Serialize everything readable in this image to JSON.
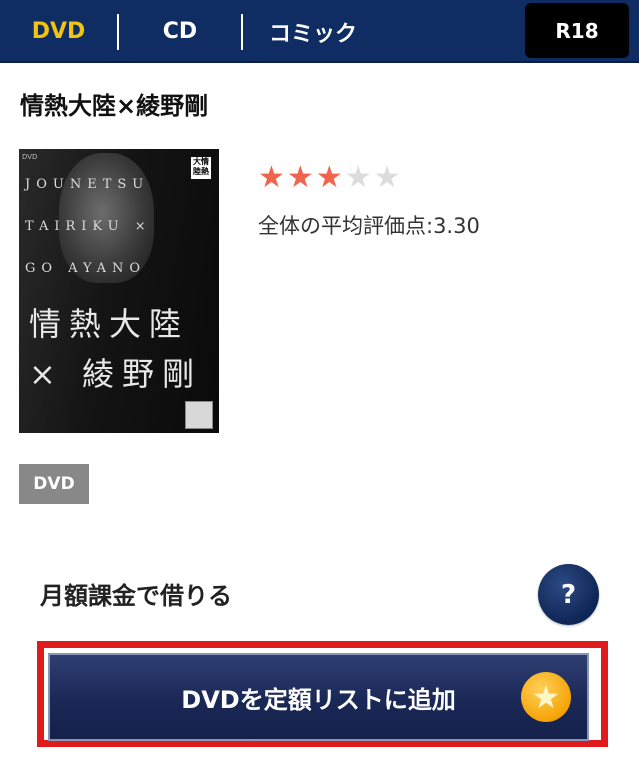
{
  "nav": {
    "tabs": [
      {
        "label": "DVD",
        "active": true
      },
      {
        "label": "CD",
        "active": false
      },
      {
        "label": "コミック",
        "active": false
      }
    ],
    "r18_label": "R18"
  },
  "product": {
    "title": "情熱大陸×綾野剛",
    "cover": {
      "small_text": "DVD",
      "badge_text": "大情\n陸熱",
      "en_lines": [
        "JOUNETSU",
        "TAIRIKU ×",
        "GO AYANO"
      ],
      "jp_lines": [
        "情熱大陸",
        "× 綾野剛"
      ]
    },
    "rating": {
      "value": 3.3,
      "max": 5
    },
    "average_label": "全体の平均評価点:3.30",
    "format": "DVD"
  },
  "rental": {
    "section_label": "月額課金で借りる",
    "help_label": "?",
    "add_button_label": "DVDを定額リストに追加"
  },
  "colors": {
    "nav_bg": "#0f2d63",
    "active_tab": "#f2c40f",
    "star_on": "#f0644d",
    "highlight": "#e01b1b"
  },
  "icons": {
    "help": "question-icon",
    "favorite": "star-icon"
  }
}
